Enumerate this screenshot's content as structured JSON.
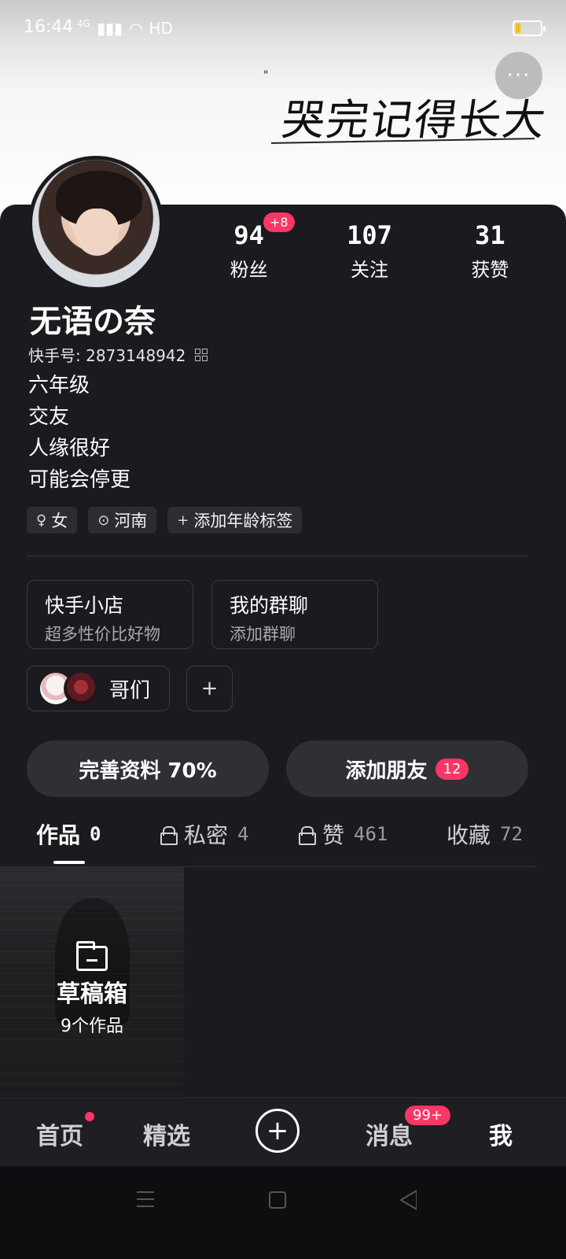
{
  "status_bar": {
    "time": "16:44",
    "network": "4G",
    "wifi_label": "HD"
  },
  "banner": {
    "quote_mark": "\"",
    "art_text": "哭完记得长大",
    "more_label": "···"
  },
  "profile": {
    "name": "无语の奈",
    "kuaishou_id": "快手号: 2873148942",
    "bio": [
      "六年级",
      "交友",
      "人缘很好",
      "可能会停更"
    ],
    "tags": [
      {
        "icon": "gender-female-icon",
        "symbol": "♀",
        "label": "女"
      },
      {
        "icon": "location-pin-icon",
        "symbol": "⊙",
        "label": "河南"
      },
      {
        "icon": "plus-icon",
        "symbol": "+",
        "label": "添加年龄标签"
      }
    ]
  },
  "stats": [
    {
      "value": "94",
      "label": "粉丝",
      "badge": "+8"
    },
    {
      "value": "107",
      "label": "关注"
    },
    {
      "value": "31",
      "label": "获赞"
    }
  ],
  "shortcuts": {
    "shop": {
      "title": "快手小店",
      "subtitle": "超多性价比好物"
    },
    "group_chat": {
      "title": "我的群聊",
      "subtitle": "添加群聊"
    }
  },
  "group": {
    "label": "哥们",
    "add_symbol": "+"
  },
  "actions": {
    "complete_profile": "完善资料 70%",
    "add_friends": "添加朋友",
    "add_friends_badge": "12"
  },
  "tabs": [
    {
      "label": "作品",
      "count": "0",
      "active": true
    },
    {
      "label": "私密",
      "count": "4",
      "locked": true
    },
    {
      "label": "赞",
      "count": "461",
      "locked": true
    },
    {
      "label": "收藏",
      "count": "72"
    }
  ],
  "draft": {
    "title": "草稿箱",
    "subtitle": "9个作品"
  },
  "bottom_nav": {
    "home": "首页",
    "featured": "精选",
    "plus": "+",
    "messages": "消息",
    "messages_badge": "99+",
    "me": "我"
  },
  "colors": {
    "accent": "#fe3666",
    "background": "#1b1b1f",
    "surface": "#2f2f34"
  }
}
